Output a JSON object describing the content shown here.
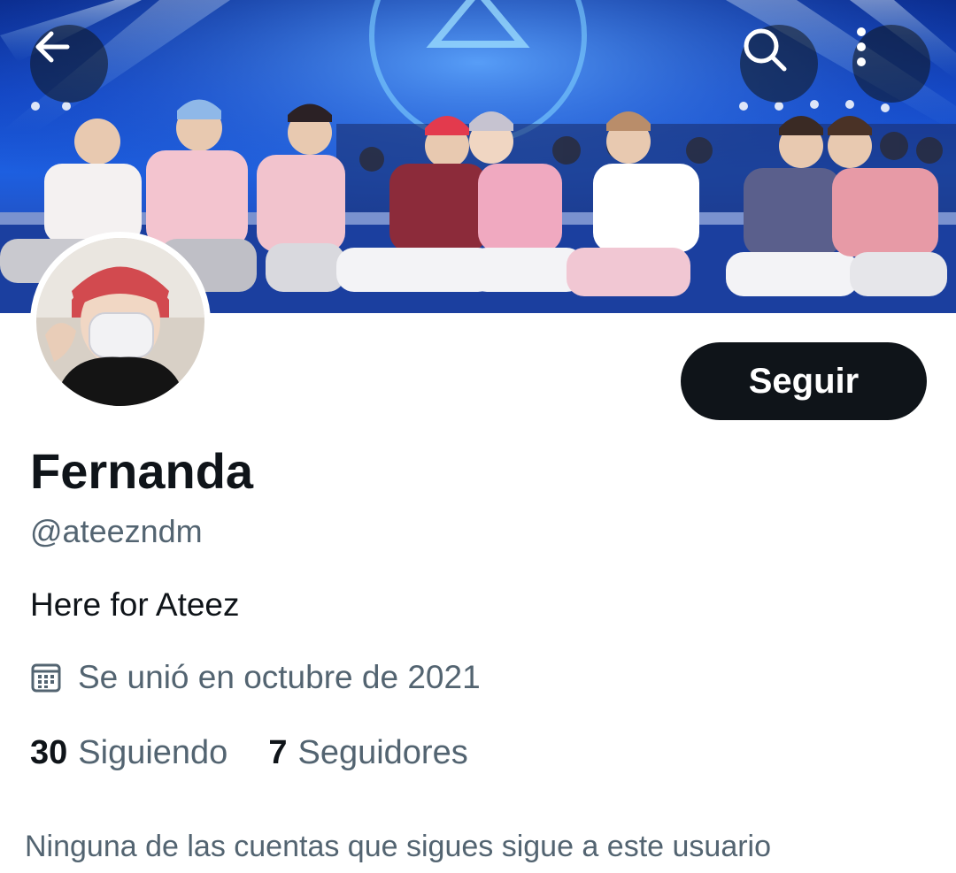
{
  "header": {
    "back_icon": "arrow-left-icon",
    "search_icon": "search-icon",
    "more_icon": "more-vertical-icon"
  },
  "banner": {
    "description_icon": "banner-photo"
  },
  "avatar": {
    "icon": "avatar-photo"
  },
  "profile": {
    "follow_label": "Seguir",
    "name": "Fernanda",
    "handle": "@ateezndm",
    "bio": "Here for Ateez",
    "joined": "Se unió en octubre de 2021",
    "following_count": "30",
    "following_label": "Siguiendo",
    "followers_count": "7",
    "followers_label": "Seguidores",
    "mutual_note": "Ninguna de las cuentas que sigues sigue a este usuario"
  },
  "colors": {
    "primary_text": "#0f1419",
    "secondary_text": "#536471",
    "button_bg": "#0f1419",
    "banner_blue": "#1d5fe0"
  }
}
